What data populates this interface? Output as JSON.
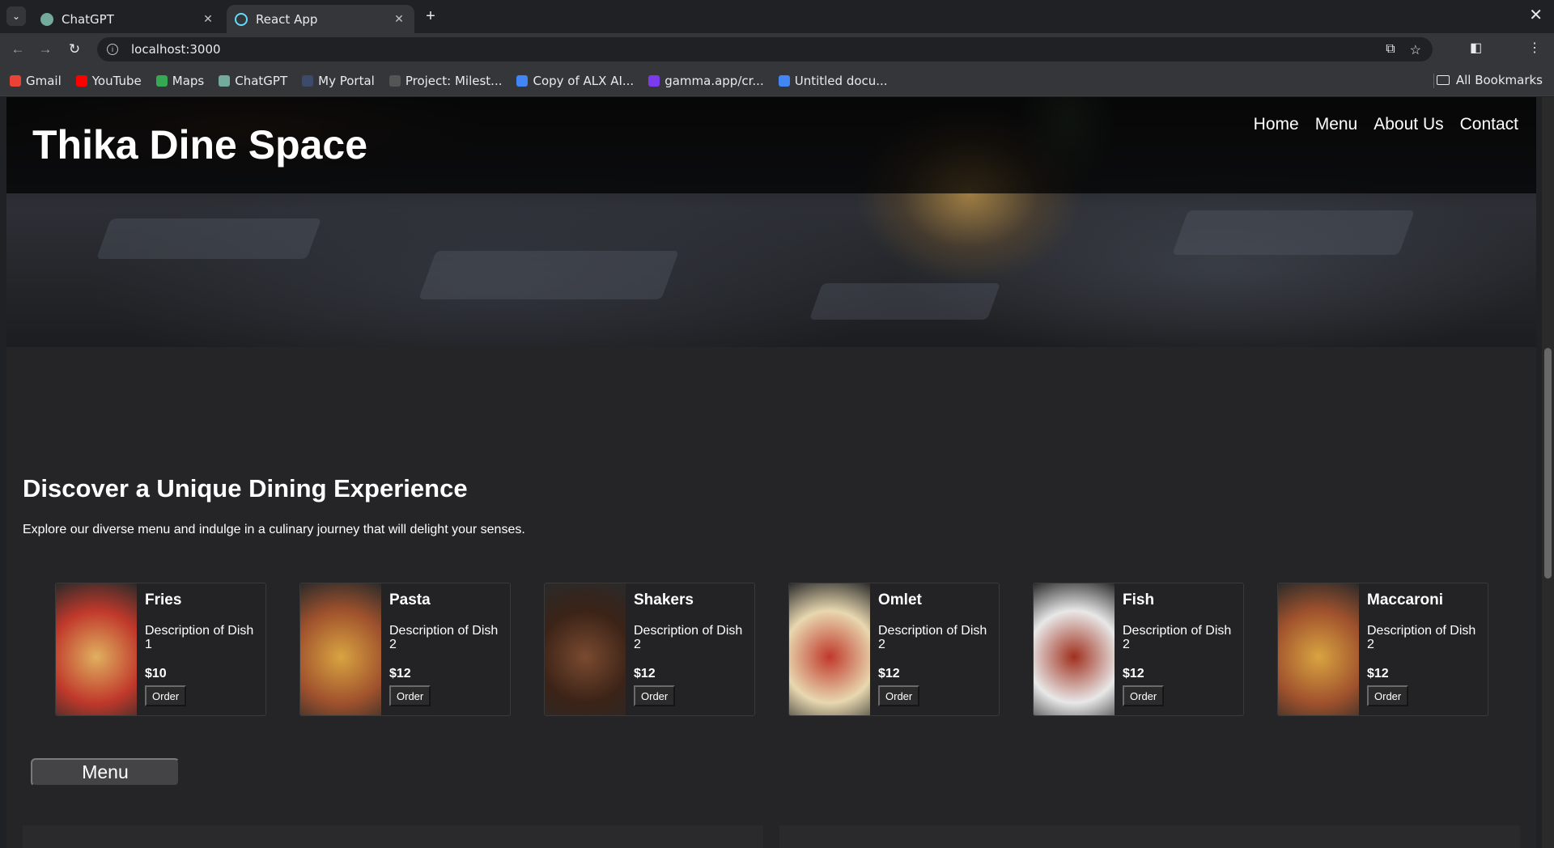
{
  "browser": {
    "tabs": [
      {
        "title": "ChatGPT",
        "active": false
      },
      {
        "title": "React App",
        "active": true
      }
    ],
    "url": "localhost:3000",
    "bookmarks": [
      {
        "label": "Gmail",
        "color": "#ea4335"
      },
      {
        "label": "YouTube",
        "color": "#ff0000"
      },
      {
        "label": "Maps",
        "color": "#34a853"
      },
      {
        "label": "ChatGPT",
        "color": "#74aa9c"
      },
      {
        "label": "My Portal",
        "color": "#3c4a6b"
      },
      {
        "label": "Project: Milest...",
        "color": "#555555"
      },
      {
        "label": "Copy of ALX AI...",
        "color": "#4285f4"
      },
      {
        "label": "gamma.app/cr...",
        "color": "#7c3aed"
      },
      {
        "label": "Untitled docu...",
        "color": "#4285f4"
      }
    ],
    "all_bookmarks": "All Bookmarks"
  },
  "site": {
    "title": "Thika Dine Space",
    "nav": [
      "Home",
      "Menu",
      "About Us",
      "Contact"
    ],
    "intro_title": "Discover a Unique Dining Experience",
    "intro_text": "Explore our diverse menu and indulge in a culinary journey that will delight your senses.",
    "dishes": [
      {
        "name": "Fries",
        "description": "Description of Dish 1",
        "price": "$10",
        "order": "Order",
        "img_colors": [
          "#c0392b",
          "#e0b060"
        ]
      },
      {
        "name": "Pasta",
        "description": "Description of Dish 2",
        "price": "$12",
        "order": "Order",
        "img_colors": [
          "#a0522d",
          "#d9a441"
        ]
      },
      {
        "name": "Shakers",
        "description": "Description of Dish 2",
        "price": "$12",
        "order": "Order",
        "img_colors": [
          "#3b2317",
          "#7a4a30"
        ]
      },
      {
        "name": "Omlet",
        "description": "Description of Dish 2",
        "price": "$12",
        "order": "Order",
        "img_colors": [
          "#e8d8b0",
          "#c0392b"
        ]
      },
      {
        "name": "Fish",
        "description": "Description of Dish 2",
        "price": "$12",
        "order": "Order",
        "img_colors": [
          "#e8e8e8",
          "#a0301e"
        ]
      },
      {
        "name": "Maccaroni",
        "description": "Description of Dish 2",
        "price": "$12",
        "order": "Order",
        "img_colors": [
          "#a0522d",
          "#d9a441"
        ]
      }
    ],
    "menu_button": "Menu"
  }
}
